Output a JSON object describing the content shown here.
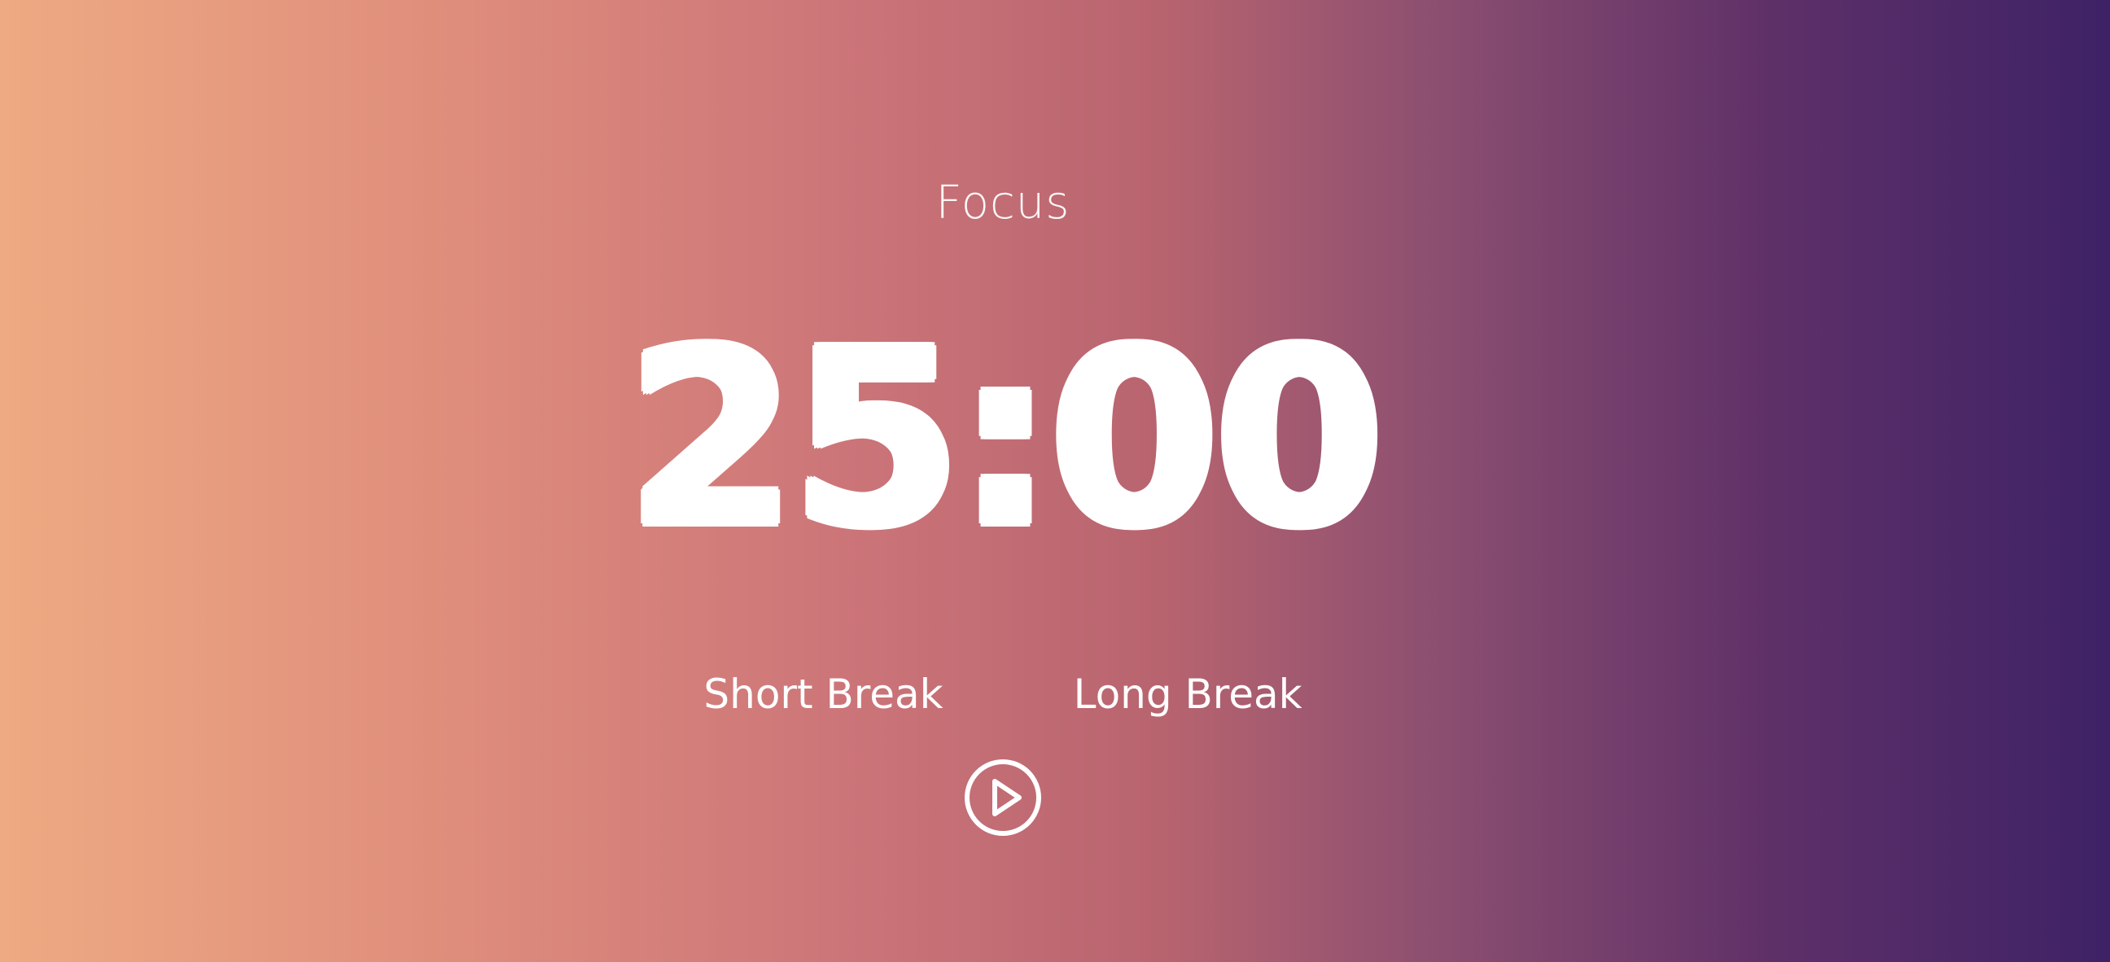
{
  "mode": {
    "title": "Focus"
  },
  "timer": {
    "display": "25:00"
  },
  "breaks": {
    "short_label": "Short Break",
    "long_label": "Long Break"
  },
  "controls": {
    "play_icon": "play-circle-icon"
  },
  "colors": {
    "gradient_start": "#eeaa82",
    "gradient_mid": "#cc7579",
    "gradient_end": "#3e2266",
    "text": "#ffffff"
  }
}
